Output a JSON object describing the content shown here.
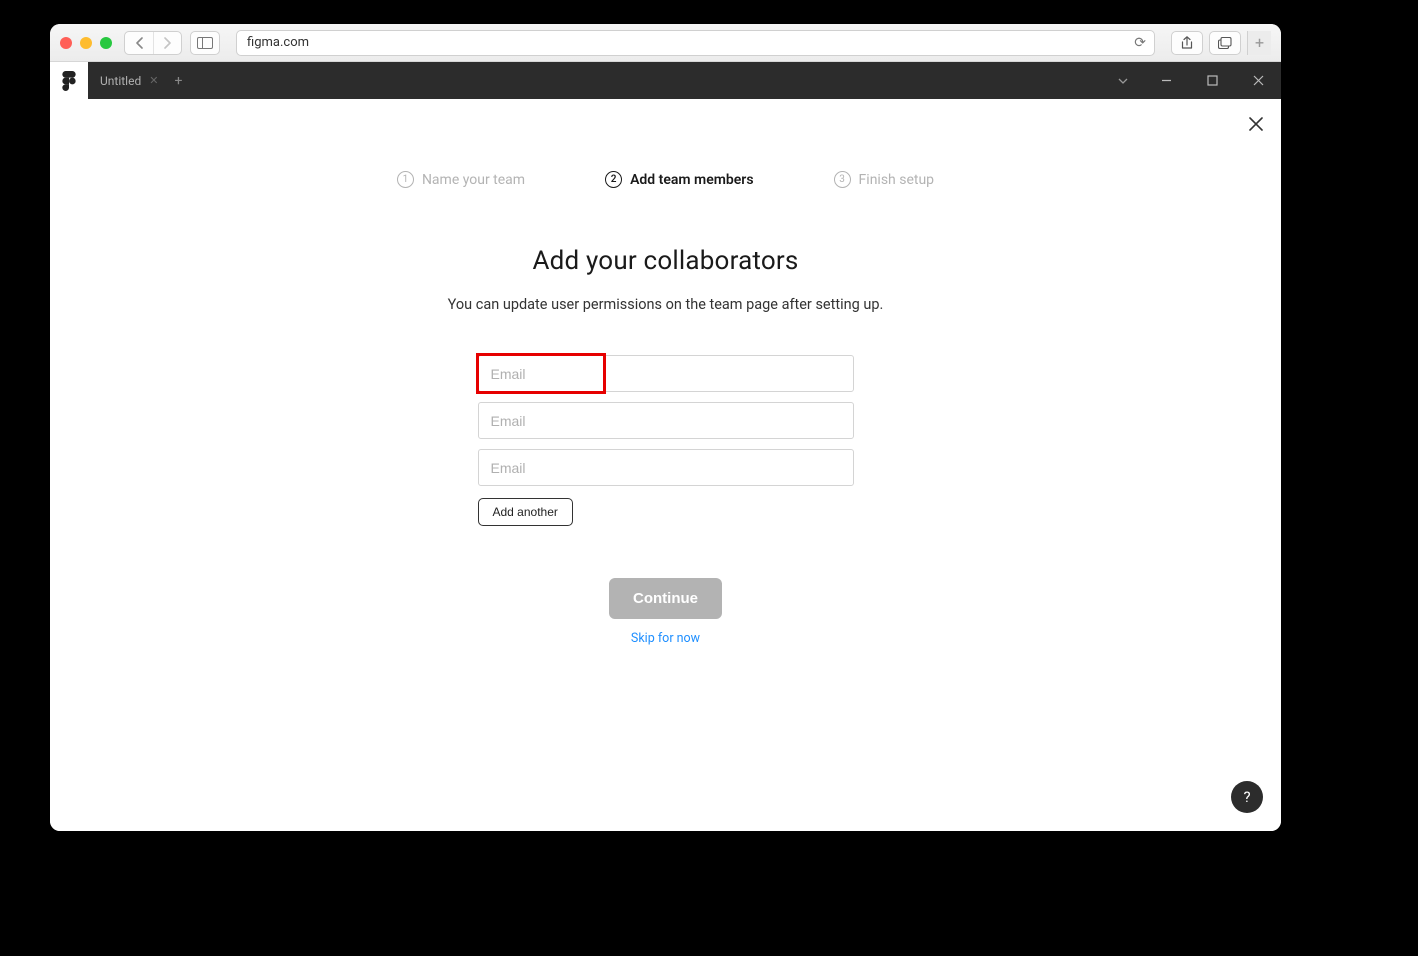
{
  "browser": {
    "url": "figma.com"
  },
  "app": {
    "tab_title": "Untitled"
  },
  "stepper": {
    "step1": {
      "num": "1",
      "label": "Name your team"
    },
    "step2": {
      "num": "2",
      "label": "Add team members"
    },
    "step3": {
      "num": "3",
      "label": "Finish setup"
    }
  },
  "form": {
    "heading": "Add your collaborators",
    "subheading": "You can update user permissions on the team page after setting up.",
    "email_placeholder": "Email",
    "add_another_label": "Add another",
    "continue_label": "Continue",
    "skip_label": "Skip for now"
  },
  "help": {
    "icon": "?"
  }
}
